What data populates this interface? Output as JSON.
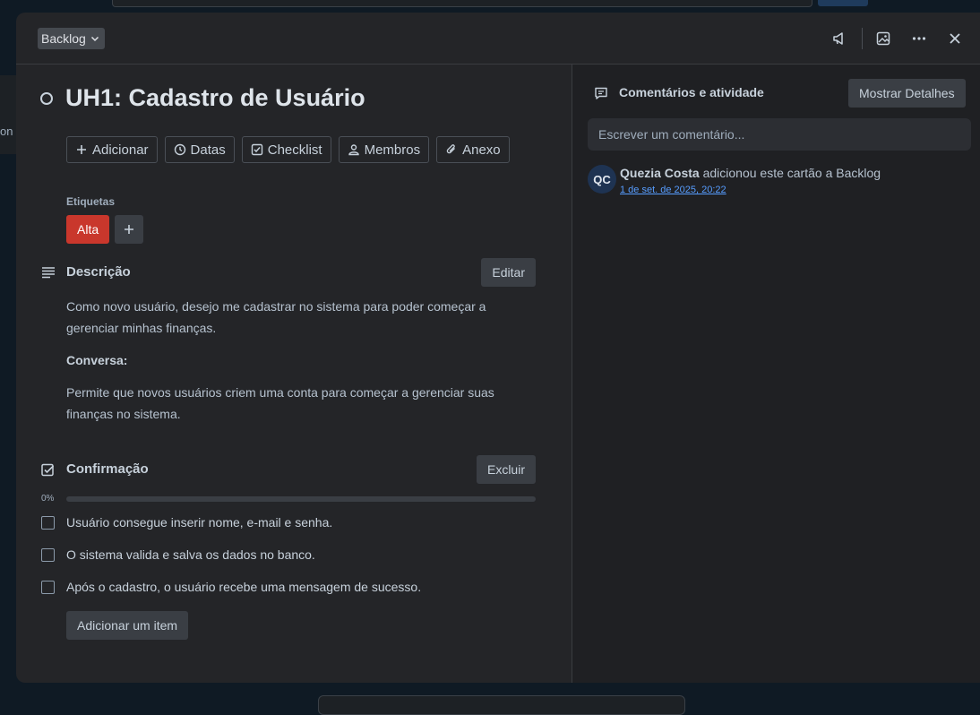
{
  "background": {
    "left_fragment": "on"
  },
  "header": {
    "list_name": "Backlog"
  },
  "card": {
    "title": "UH1: Cadastro de Usuário",
    "actions": [
      "Adicionar",
      "Datas",
      "Checklist",
      "Membros",
      "Anexo"
    ],
    "labels_heading": "Etiquetas",
    "label": "Alta",
    "label_color": "#c9372c",
    "description": {
      "heading": "Descrição",
      "edit_label": "Editar",
      "paragraph1": "Como novo usuário, desejo me cadastrar no sistema para poder começar a gerenciar minhas finanças.",
      "conversation_heading": "Conversa:",
      "paragraph2": "Permite que novos usuários criem uma conta para começar a gerenciar suas finanças no sistema."
    },
    "checklist": {
      "heading": "Confirmação",
      "delete_label": "Excluir",
      "progress_label": "0%",
      "progress": 0,
      "items": [
        "Usuário consegue inserir nome, e-mail e senha.",
        "O sistema valida e salva os dados no banco.",
        "Após o cadastro, o usuário recebe uma mensagem de sucesso."
      ],
      "add_item_label": "Adicionar um item"
    }
  },
  "activity": {
    "heading": "Comentários e atividade",
    "details_button": "Mostrar Detalhes",
    "comment_placeholder": "Escrever um comentário...",
    "entries": [
      {
        "initials": "QC",
        "user": "Quezia Costa",
        "text": "adicionou este cartão a Backlog",
        "timestamp": "1 de set. de 2025, 20:22"
      }
    ]
  },
  "colors": {
    "modal_bg": "#242528",
    "accent_link": "#579dff"
  }
}
